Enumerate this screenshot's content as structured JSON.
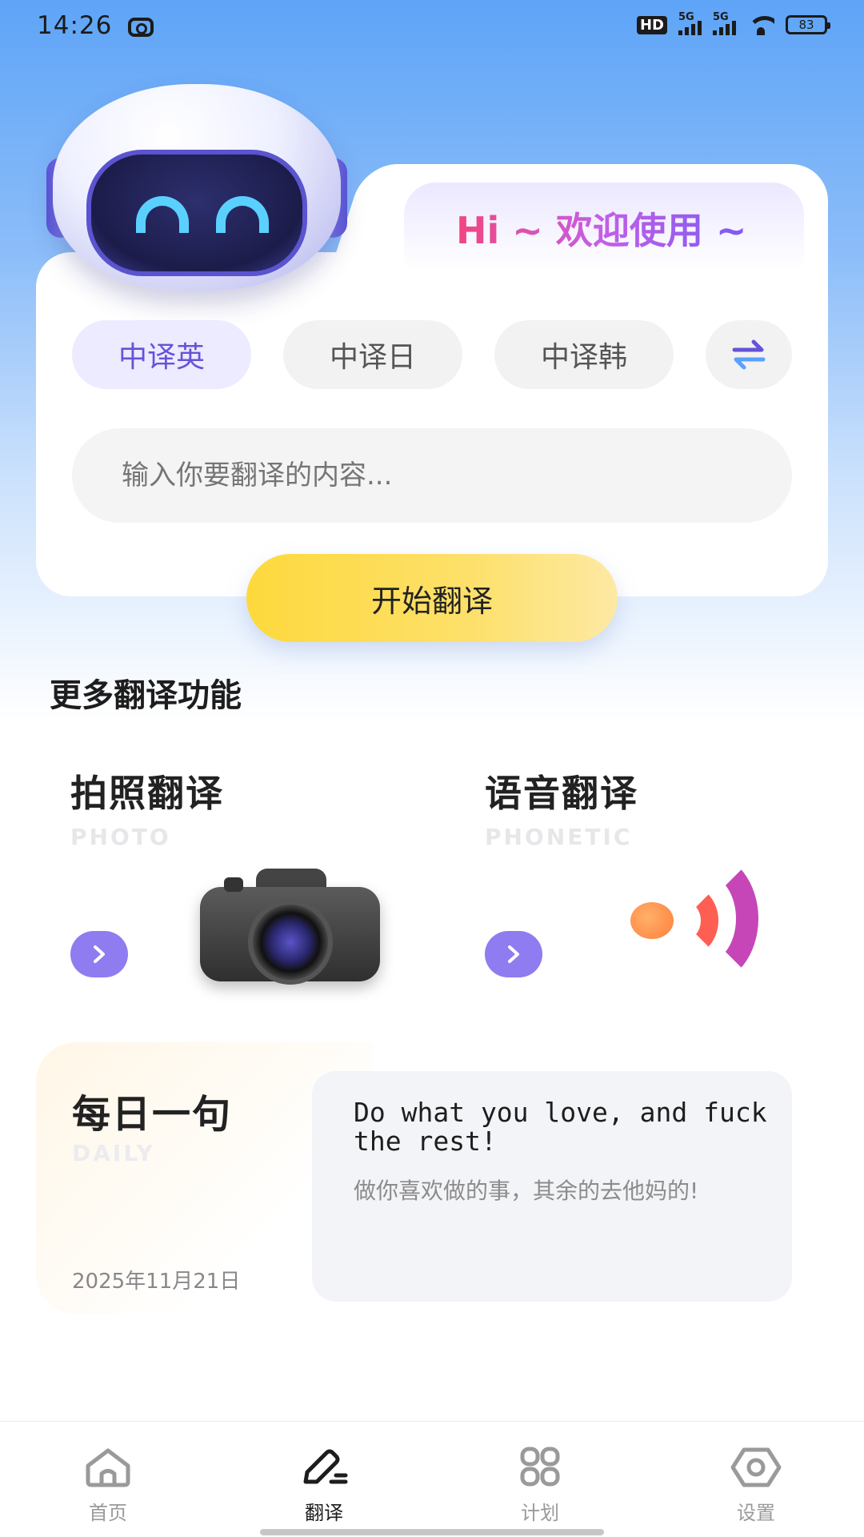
{
  "status_bar": {
    "time": "14:26",
    "hd_label": "HD",
    "signal1_label": "5G",
    "signal2_label": "5G",
    "battery": "83"
  },
  "hero": {
    "greeting": "Hi ~ 欢迎使用 ~"
  },
  "translator": {
    "tabs": [
      {
        "label": "中译英",
        "active": true
      },
      {
        "label": "中译日",
        "active": false
      },
      {
        "label": "中译韩",
        "active": false
      }
    ],
    "input_placeholder": "输入你要翻译的内容...",
    "start_label": "开始翻译"
  },
  "more": {
    "title": "更多翻译功能",
    "features": [
      {
        "title": "拍照翻译",
        "subtitle": "PHOTO",
        "icon": "camera-icon"
      },
      {
        "title": "语音翻译",
        "subtitle": "PHONETIC",
        "icon": "sound-wave-icon"
      }
    ]
  },
  "daily": {
    "title": "每日一句",
    "subtitle": "DAILY",
    "date": "2025年11月21日",
    "quote_en": "Do what you love, and fuck the rest!",
    "quote_cn": "做你喜欢做的事，其余的去他妈的!"
  },
  "nav": {
    "items": [
      {
        "label": "首页",
        "icon": "home-icon",
        "active": false
      },
      {
        "label": "翻译",
        "icon": "pen-icon",
        "active": true
      },
      {
        "label": "计划",
        "icon": "grid-icon",
        "active": false
      },
      {
        "label": "设置",
        "icon": "hexagon-settings-icon",
        "active": false
      }
    ]
  },
  "colors": {
    "accent": "#6553d8",
    "button_yellow": "#fdd93d",
    "arrow_purple": "#8f7cf1"
  }
}
